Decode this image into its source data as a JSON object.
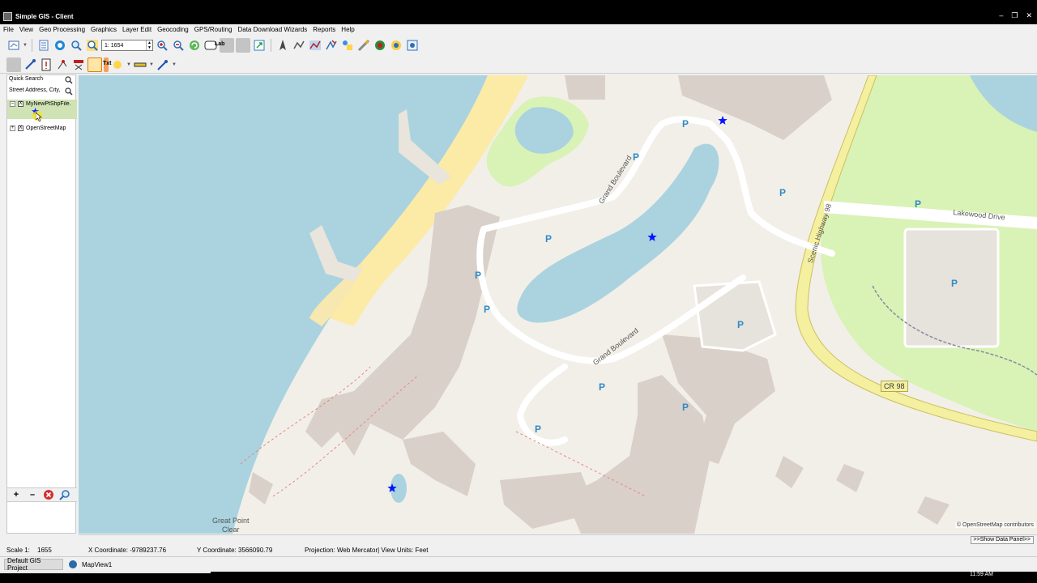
{
  "window": {
    "title": "Simple GIS - Client",
    "minimize": "–",
    "restore": "❐",
    "close": "✕"
  },
  "menu": [
    "File",
    "View",
    "Geo Processing",
    "Graphics",
    "Layer Edit",
    "Geocoding",
    "GPS/Routing",
    "Data Download Wizards",
    "Reports",
    "Help"
  ],
  "toolbar": {
    "scale_value": "1: 1654",
    "label_button": "Lab",
    "text_button": "Txt"
  },
  "left_panel": {
    "quick_search": "Quick Search",
    "address_placeholder": "Street Address, City,",
    "layers": [
      {
        "name": "MyNewPtShpFile.",
        "expander": "–",
        "checked": "X"
      },
      {
        "name": "OpenStreetMap",
        "expander": "+",
        "checked": "X"
      }
    ],
    "tools": {
      "add": "+",
      "remove": "–"
    }
  },
  "map": {
    "labels": {
      "grand_boulevard_1": "Grand Boulevard",
      "grand_boulevard_2": "Grand Boulevard",
      "lakewood_drive": "Lakewood Drive",
      "scenic_highway": "Scenic Highway 98",
      "cr98": "CR 98",
      "great_point_clear_1": "Great Point",
      "great_point_clear_2": "Clear",
      "parking": "P"
    },
    "credit": "© OpenStreetMap contributors",
    "colors": {
      "water": "#aad3df",
      "land": "#f2efe9",
      "beach": "#fbeba6",
      "building": "#d9d0c9",
      "park": "#d9f2b6",
      "road": "#ffffff",
      "highway": "#f5f0a0",
      "marker": "#0015ff"
    }
  },
  "show_data_panel": ">>Show Data Panel>>",
  "status": {
    "scale_label": "Scale 1:",
    "scale_value": "1655",
    "x_coord": "X Coordinate: -9789237.76",
    "y_coord": "Y Coordinate: 3566090.79",
    "projection": "Projection: Web Mercator| View Units: Feet"
  },
  "tabs": {
    "project": "Default GIS Project",
    "mapview": "MapView1"
  },
  "taskbar": {
    "clock": "11:59 AM"
  }
}
